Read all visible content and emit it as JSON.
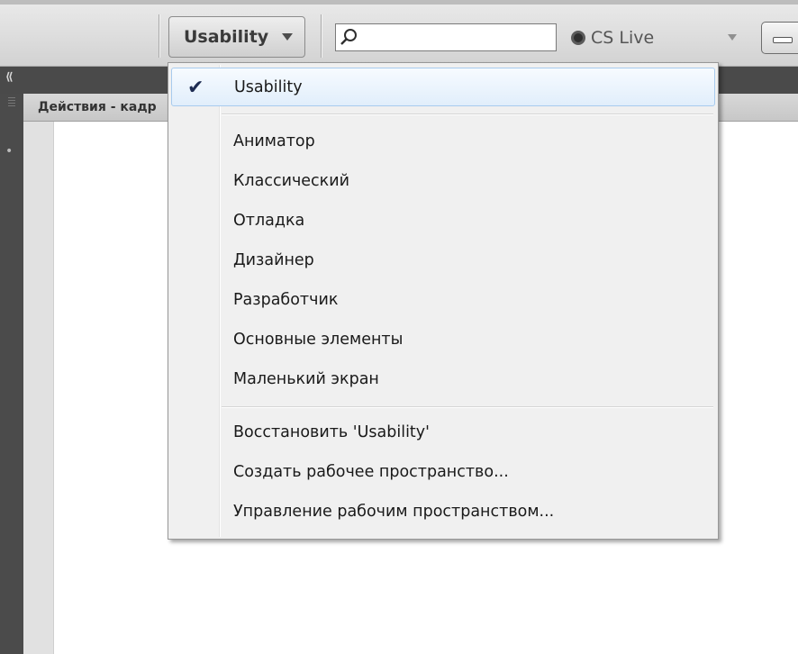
{
  "toolbar": {
    "workspace_button_label": "Usability",
    "search_value": "",
    "cs_live_label": "CS Live"
  },
  "panel": {
    "title": "Действия - кадр"
  },
  "workspace_menu": {
    "selected": "Usability",
    "presets": [
      "Аниматор",
      "Классический",
      "Отладка",
      "Дизайнер",
      "Разработчик",
      "Основные элементы",
      "Маленький экран"
    ],
    "actions": [
      "Восстановить 'Usability'",
      "Создать рабочее пространство...",
      "Управление рабочим пространством..."
    ]
  }
}
